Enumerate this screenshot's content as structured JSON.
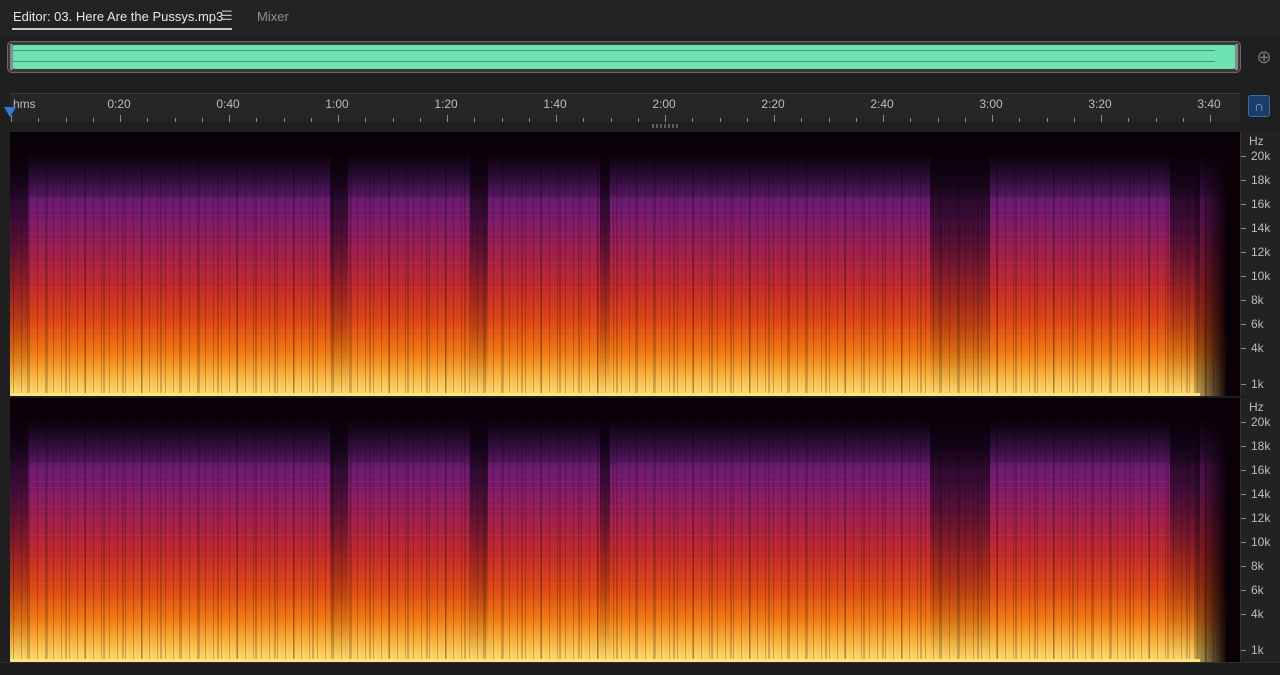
{
  "tabs": {
    "editor_label": "Editor: 03. Here Are the Pussys.mp3",
    "menu_icon": "☰",
    "mixer_label": "Mixer"
  },
  "overview": {
    "wave_color": "#6ee3b0"
  },
  "ruler": {
    "unit": "hms",
    "labels": [
      "0:20",
      "0:40",
      "1:00",
      "1:20",
      "1:40",
      "2:00",
      "2:20",
      "2:40",
      "3:00",
      "3:20",
      "3:40"
    ]
  },
  "spectral": {
    "hz_unit": "Hz",
    "hz_labels": [
      "20k",
      "18k",
      "16k",
      "14k",
      "12k",
      "10k",
      "8k",
      "6k",
      "4k",
      "1k"
    ],
    "colors": {
      "low": "#3f1a60",
      "mid": "#c22a2a",
      "high": "#ffe07a"
    }
  },
  "icons": {
    "zoom": "zoom-icon",
    "snap": "snap-icon",
    "menu": "hamburger-menu-icon"
  }
}
